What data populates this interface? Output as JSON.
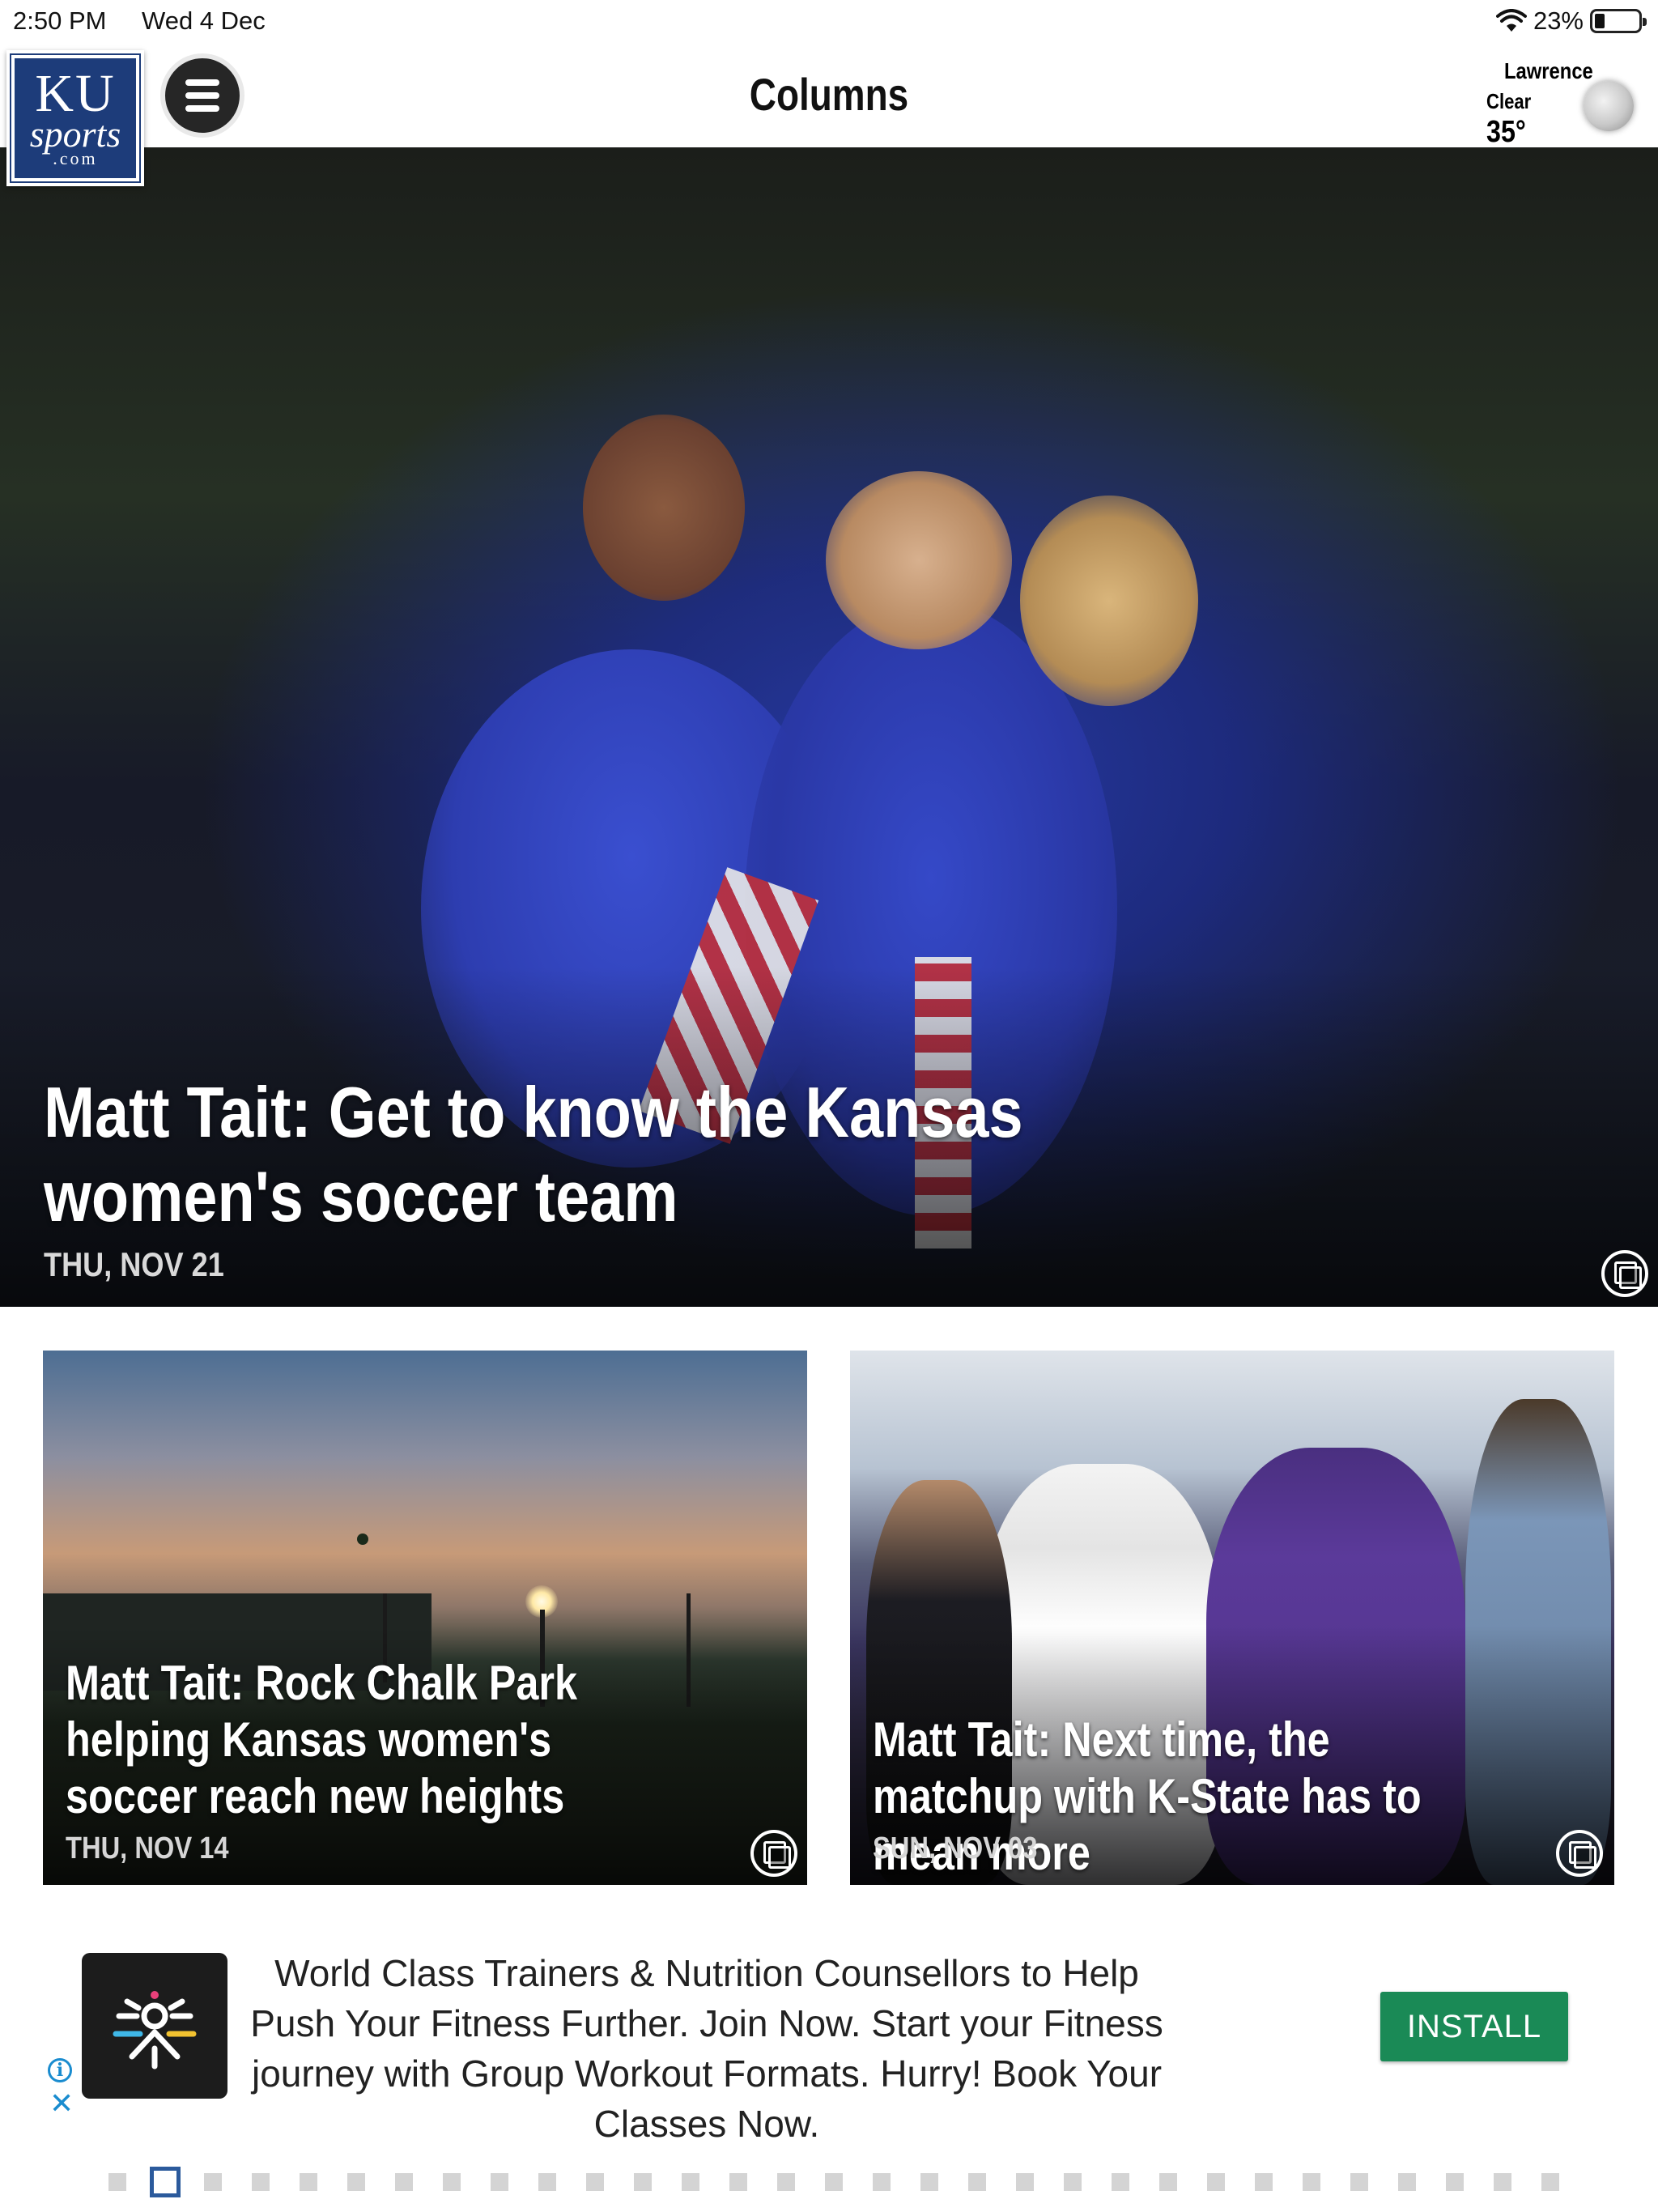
{
  "status_bar": {
    "time": "2:50 PM",
    "date": "Wed 4 Dec",
    "battery": "23%"
  },
  "header": {
    "logo": {
      "line1": "KU",
      "line2": "sports",
      "line3": ".com"
    },
    "title": "Columns",
    "weather": {
      "city": "Lawrence",
      "condition": "Clear",
      "temperature": "35°",
      "icon": "moon-icon"
    }
  },
  "hero": {
    "title": "Matt Tait: Get to know the Kansas women's soccer team",
    "date": "THU, NOV 21",
    "icon": "gallery-icon"
  },
  "cards": [
    {
      "title": "Matt Tait: Rock Chalk Park helping Kansas women's soccer reach new heights",
      "date": "THU, NOV 14",
      "icon": "gallery-icon"
    },
    {
      "title": "Matt Tait: Next time, the matchup with K-State has to mean more",
      "date": "SUN, NOV 03",
      "icon": "gallery-icon"
    }
  ],
  "ad": {
    "text": "World Class Trainers & Nutrition Counsellors to Help Push Your Fitness Further. Join Now. Start your Fitness journey with Group Workout Formats. Hurry! Book Your Classes Now.",
    "install_label": "INSTALL",
    "info_icon": "info-icon",
    "close_icon": "close-icon",
    "colors": {
      "install_bg": "#1a8a56",
      "info": "#1a8ccf"
    }
  },
  "pager": {
    "total": 31,
    "active_index": 1
  },
  "colors": {
    "ku_blue": "#1d3c7a",
    "pager_active": "#2b5a9c"
  }
}
